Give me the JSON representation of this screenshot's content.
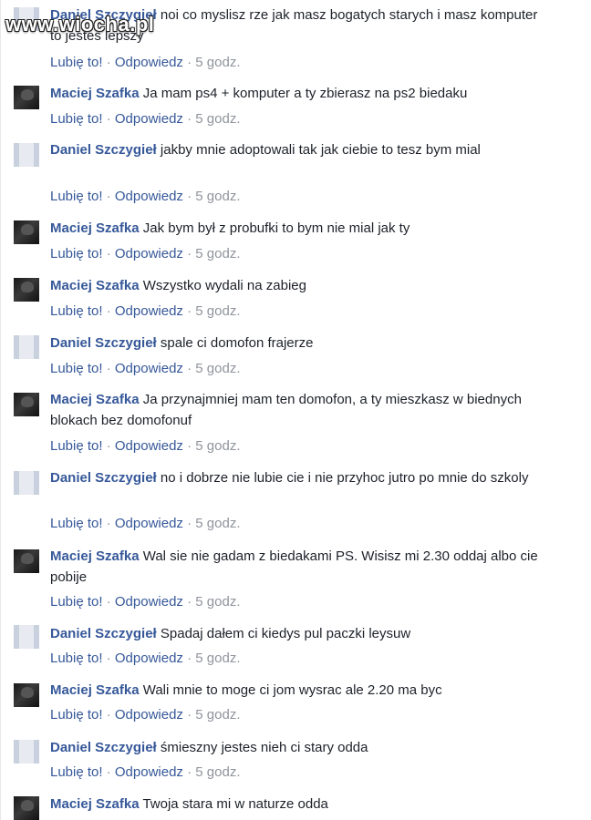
{
  "watermark": "www.wiocha.pl",
  "actions": {
    "like": "Lubię to!",
    "reply": "Odpowiedz",
    "separator": "·",
    "time": "5 godz."
  },
  "comments": [
    {
      "author": "Daniel Szczygieł",
      "avatar": "gray",
      "text": "noi co myslisz rze jak masz bogatych starych i masz komputer to jestes lepszy"
    },
    {
      "author": "Maciej Szafka",
      "avatar": "dark",
      "text": "Ja mam ps4 + komputer a ty zbierasz na ps2 biedaku"
    },
    {
      "author": "Daniel Szczygieł",
      "avatar": "gray",
      "text": "jakby mnie adoptowali tak jak ciebie to tesz bym mial"
    },
    {
      "author": "Maciej Szafka",
      "avatar": "dark",
      "text": "Jak bym był z probufki to bym nie mial jak ty"
    },
    {
      "author": "Maciej Szafka",
      "avatar": "dark",
      "text": "Wszystko wydali na zabieg"
    },
    {
      "author": "Daniel Szczygieł",
      "avatar": "gray",
      "text": "spale ci domofon frajerze"
    },
    {
      "author": "Maciej Szafka",
      "avatar": "dark",
      "text": "Ja przynajmniej mam ten domofon, a ty mieszkasz w biednych blokach bez domofonuf"
    },
    {
      "author": "Daniel Szczygieł",
      "avatar": "gray",
      "text": "no i dobrze nie lubie cie i nie przyhoc jutro po mnie do szkoly"
    },
    {
      "author": "Maciej Szafka",
      "avatar": "dark",
      "text": "Wal sie nie gadam z biedakami PS. Wisisz mi 2.30 oddaj albo cie pobije"
    },
    {
      "author": "Daniel Szczygieł",
      "avatar": "gray",
      "text": "Spadaj dałem ci kiedys pul paczki leysuw"
    },
    {
      "author": "Maciej Szafka",
      "avatar": "dark",
      "text": "Wali mnie to moge ci jom wysrac ale 2.20 ma byc"
    },
    {
      "author": "Daniel Szczygieł",
      "avatar": "gray",
      "text": "śmieszny jestes nieh ci stary odda"
    },
    {
      "author": "Maciej Szafka",
      "avatar": "dark",
      "text": "Twoja stara mi w naturze odda"
    }
  ]
}
